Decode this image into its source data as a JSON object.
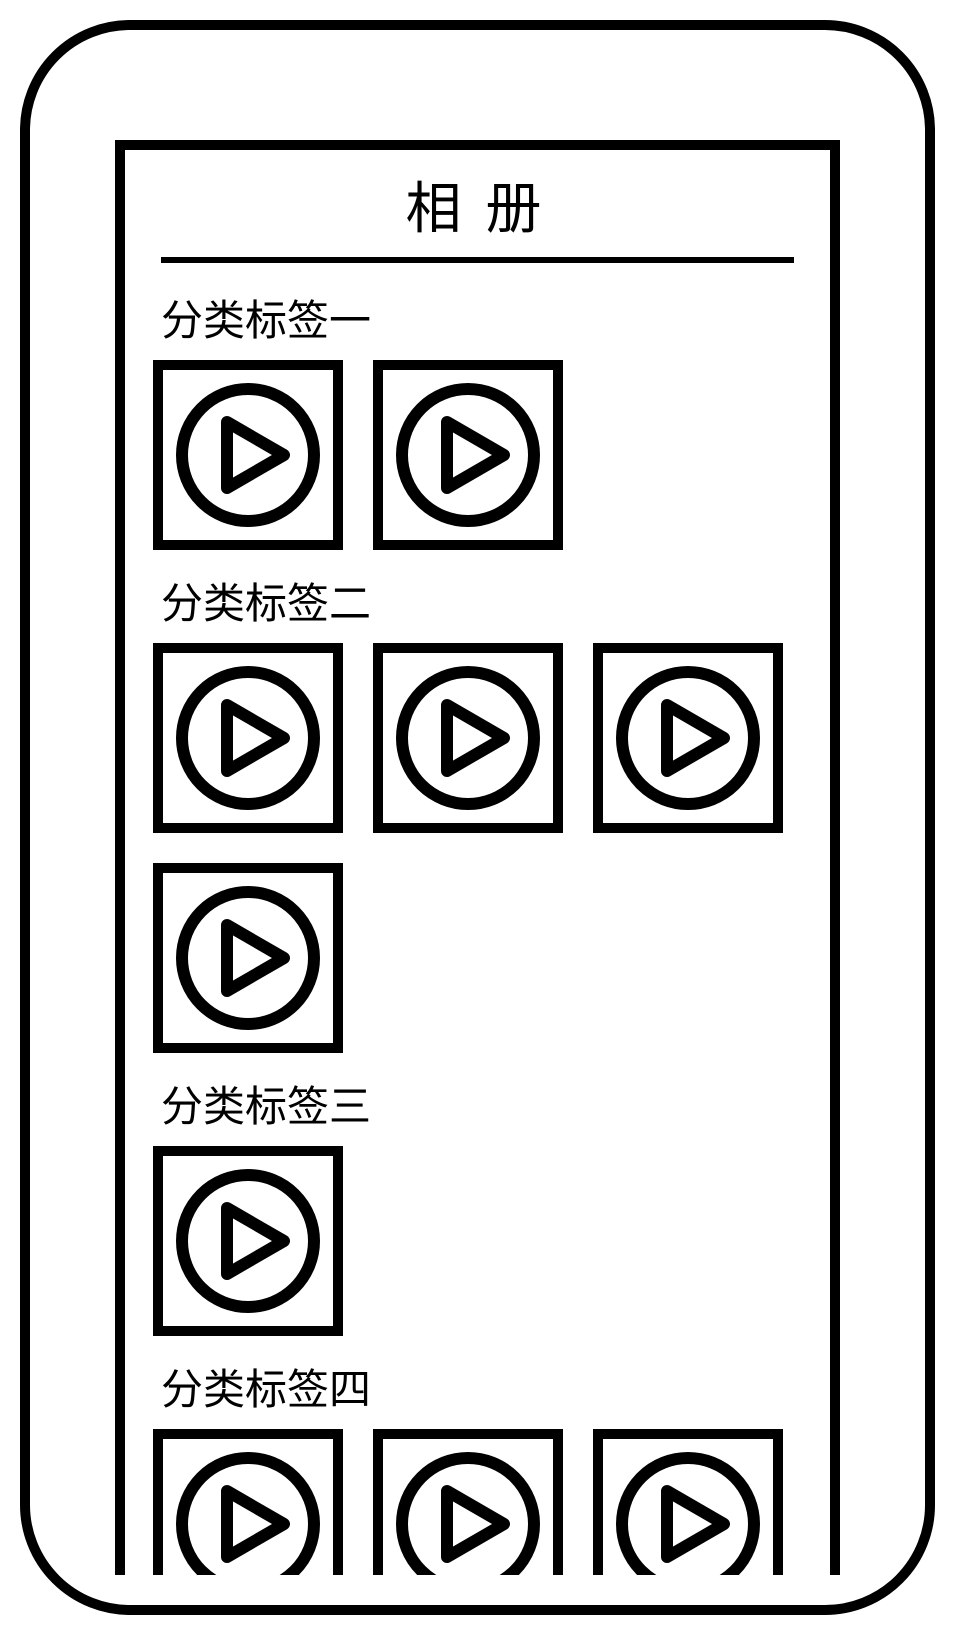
{
  "header": {
    "title": "相册"
  },
  "categories": [
    {
      "label": "分类标签一",
      "items": [
        {
          "icon": "play"
        },
        {
          "icon": "play"
        }
      ]
    },
    {
      "label": "分类标签二",
      "items": [
        {
          "icon": "play"
        },
        {
          "icon": "play"
        },
        {
          "icon": "play"
        },
        {
          "icon": "play"
        }
      ]
    },
    {
      "label": "分类标签三",
      "items": [
        {
          "icon": "play"
        }
      ]
    },
    {
      "label": "分类标签四",
      "items": [
        {
          "icon": "play"
        },
        {
          "icon": "play"
        },
        {
          "icon": "play"
        }
      ]
    }
  ],
  "icons": {
    "play": "play-icon"
  }
}
